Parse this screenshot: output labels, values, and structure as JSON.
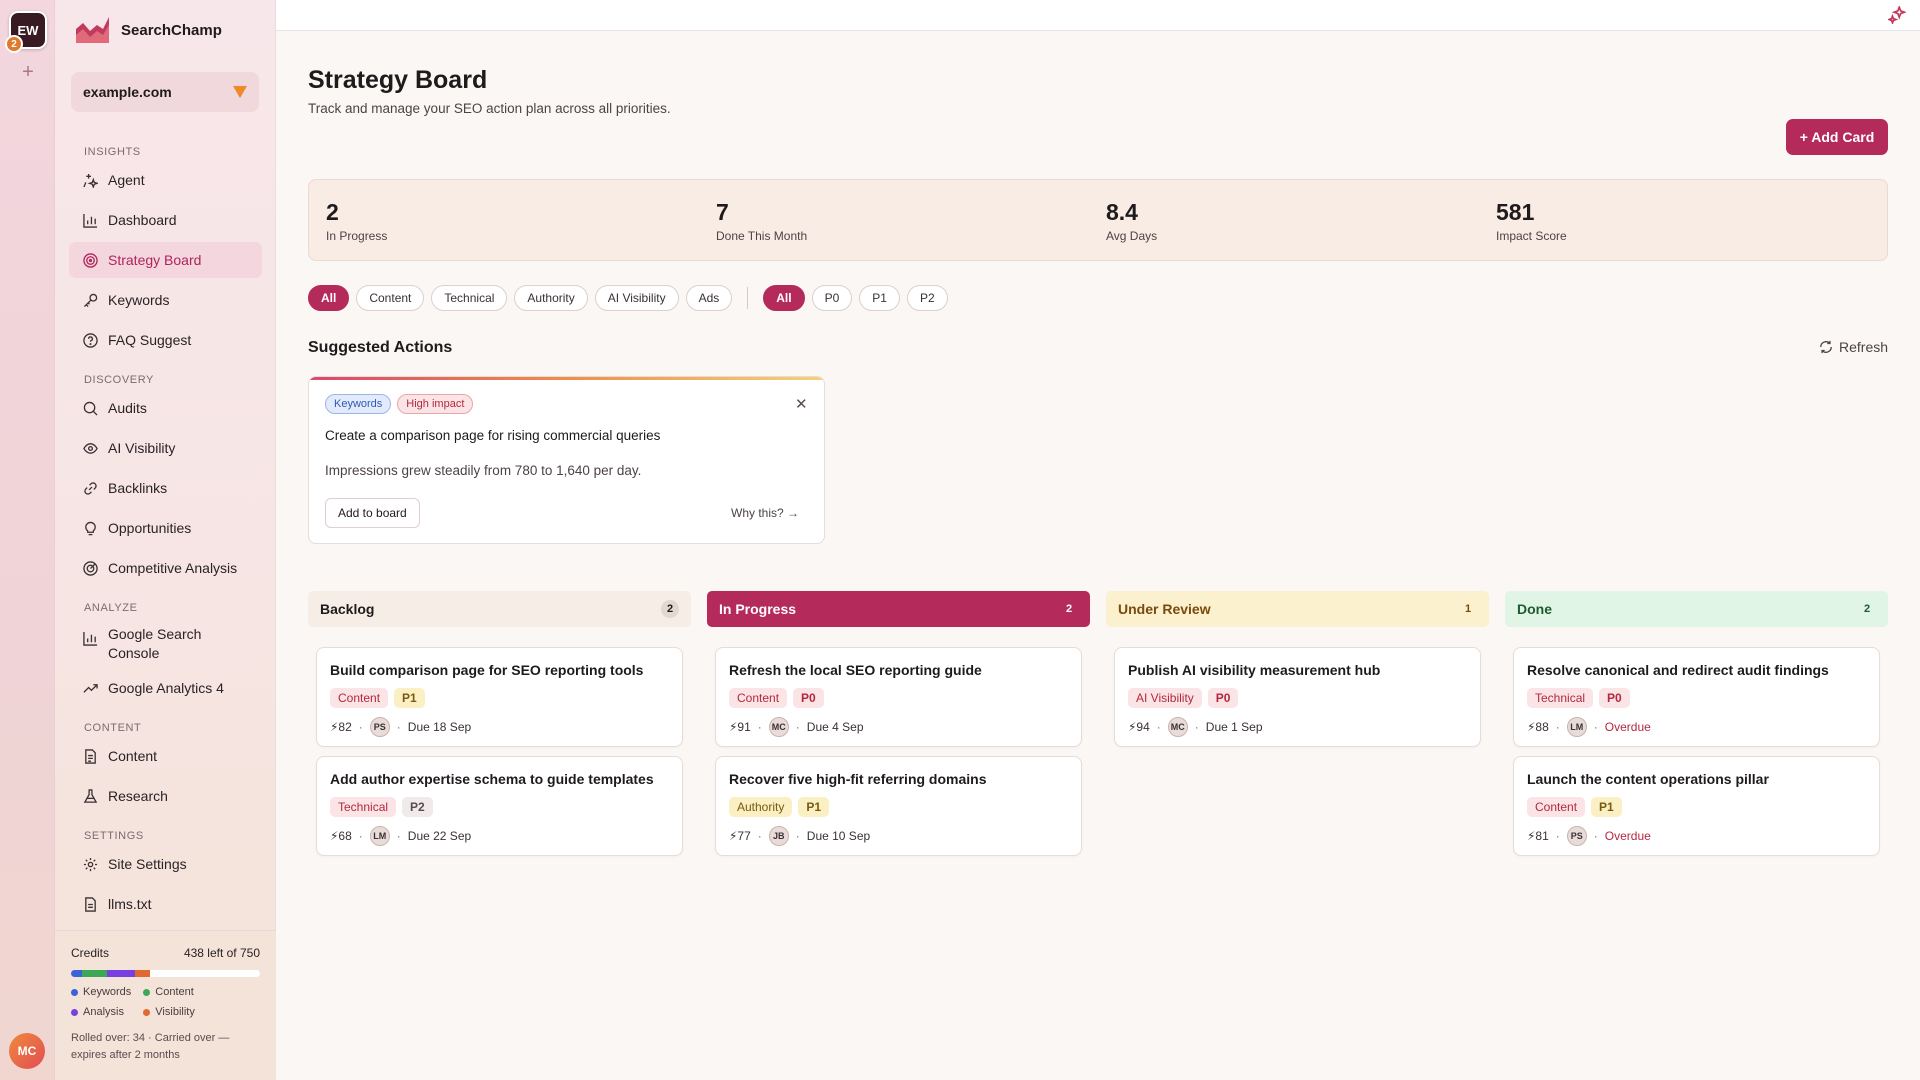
{
  "app": {
    "name": "SearchChamp",
    "workspace_initials": "EW",
    "workspace_badge": "2",
    "user_initials": "MC"
  },
  "site": {
    "selected": "example.com"
  },
  "nav": {
    "sections": [
      {
        "label": "INSIGHTS",
        "items": [
          "Agent",
          "Dashboard",
          "Strategy Board",
          "Keywords",
          "FAQ Suggest"
        ]
      },
      {
        "label": "DISCOVERY",
        "items": [
          "Audits",
          "AI Visibility",
          "Backlinks",
          "Opportunities",
          "Competitive Analysis"
        ]
      },
      {
        "label": "ANALYZE",
        "items": [
          "Google Search Console",
          "Google Analytics 4"
        ]
      },
      {
        "label": "CONTENT",
        "items": [
          "Content",
          "Research"
        ]
      },
      {
        "label": "SETTINGS",
        "items": [
          "Site Settings",
          "llms.txt"
        ]
      }
    ],
    "active": "Strategy Board"
  },
  "credits": {
    "label": "Credits",
    "remaining_text": "438 left of 750",
    "segments": [
      {
        "name": "Keywords",
        "fraction": 0.06,
        "color": "#3b63d6"
      },
      {
        "name": "Content",
        "fraction": 0.13,
        "color": "#3aa857"
      },
      {
        "name": "Analysis",
        "fraction": 0.15,
        "color": "#7a3fe0"
      },
      {
        "name": "Visibility",
        "fraction": 0.08,
        "color": "#e06a2f"
      }
    ],
    "legend": [
      "Keywords",
      "Content",
      "Analysis",
      "Visibility"
    ],
    "rolled_over": "Rolled over: 34 · Carried over — expires after 2 months"
  },
  "page": {
    "title": "Strategy Board",
    "subtitle": "Track and manage your SEO action plan across all priorities.",
    "add_card_label": "+ Add Card"
  },
  "stats": [
    {
      "value": "2",
      "label": "In Progress"
    },
    {
      "value": "7",
      "label": "Done This Month"
    },
    {
      "value": "8.4",
      "label": "Avg Days"
    },
    {
      "value": "581",
      "label": "Impact Score"
    }
  ],
  "filters": {
    "categories": [
      "All",
      "Content",
      "Technical",
      "Authority",
      "AI Visibility",
      "Ads"
    ],
    "priorities": [
      "All",
      "P0",
      "P1",
      "P2"
    ],
    "active_category": "All",
    "active_priority": "All"
  },
  "suggested": {
    "title": "Suggested Actions",
    "refresh_label": "Refresh",
    "card": {
      "tags": [
        "Keywords",
        "High impact"
      ],
      "headline": "Create a comparison page for rising commercial queries",
      "body": "Impressions grew steadily from 780 to 1,640 per day.",
      "add_label": "Add to board",
      "why_label": "Why this? →"
    }
  },
  "columns": [
    {
      "name": "Backlog",
      "count": "2",
      "head_bg": "#f6ede6",
      "head_fg": "#1f1a1c",
      "badge_bg": "#e4d6d0",
      "badge_fg": "#1f1a1c",
      "cards": [
        {
          "title": "Build comparison page for SEO reporting tools",
          "category": "Content",
          "priority": "P1",
          "score": "⚡82",
          "assignee": "PS",
          "due": "Due 18 Sep",
          "overdue": false
        },
        {
          "title": "Add author expertise schema to guide templates",
          "category": "Technical",
          "priority": "P2",
          "score": "⚡68",
          "assignee": "LM",
          "due": "Due 22 Sep",
          "overdue": false
        }
      ]
    },
    {
      "name": "In Progress",
      "count": "2",
      "head_bg": "#b42a5a",
      "head_fg": "#ffffff",
      "badge_bg": "#b42a5a",
      "badge_fg": "#ffffff",
      "cards": [
        {
          "title": "Refresh the local SEO reporting guide",
          "category": "Content",
          "priority": "P0",
          "score": "⚡91",
          "assignee": "MC",
          "due": "Due 4 Sep",
          "overdue": false
        },
        {
          "title": "Recover five high-fit referring domains",
          "category": "Authority",
          "priority": "P1",
          "score": "⚡77",
          "assignee": "JB",
          "due": "Due 10 Sep",
          "overdue": false
        }
      ]
    },
    {
      "name": "Under Review",
      "count": "1",
      "head_bg": "#fbf1cf",
      "head_fg": "#7a4a0b",
      "badge_bg": "#fbf1cf",
      "badge_fg": "#7a4a0b",
      "cards": [
        {
          "title": "Publish AI visibility measurement hub",
          "category": "AI Visibility",
          "priority": "P0",
          "score": "⚡94",
          "assignee": "MC",
          "due": "Due 1 Sep",
          "overdue": false
        }
      ]
    },
    {
      "name": "Done",
      "count": "2",
      "head_bg": "#e1f5e6",
      "head_fg": "#1f5a30",
      "badge_bg": "#e1f5e6",
      "badge_fg": "#1f5a30",
      "cards": [
        {
          "title": "Resolve canonical and redirect audit findings",
          "category": "Technical",
          "priority": "P0",
          "score": "⚡88",
          "assignee": "LM",
          "due": "Overdue",
          "overdue": true
        },
        {
          "title": "Launch the content operations pillar",
          "category": "Content",
          "priority": "P1",
          "score": "⚡81",
          "assignee": "PS",
          "due": "Overdue",
          "overdue": true
        }
      ]
    }
  ],
  "colors": {
    "accent": "#b42a5a",
    "overdue": "#b4283f"
  }
}
